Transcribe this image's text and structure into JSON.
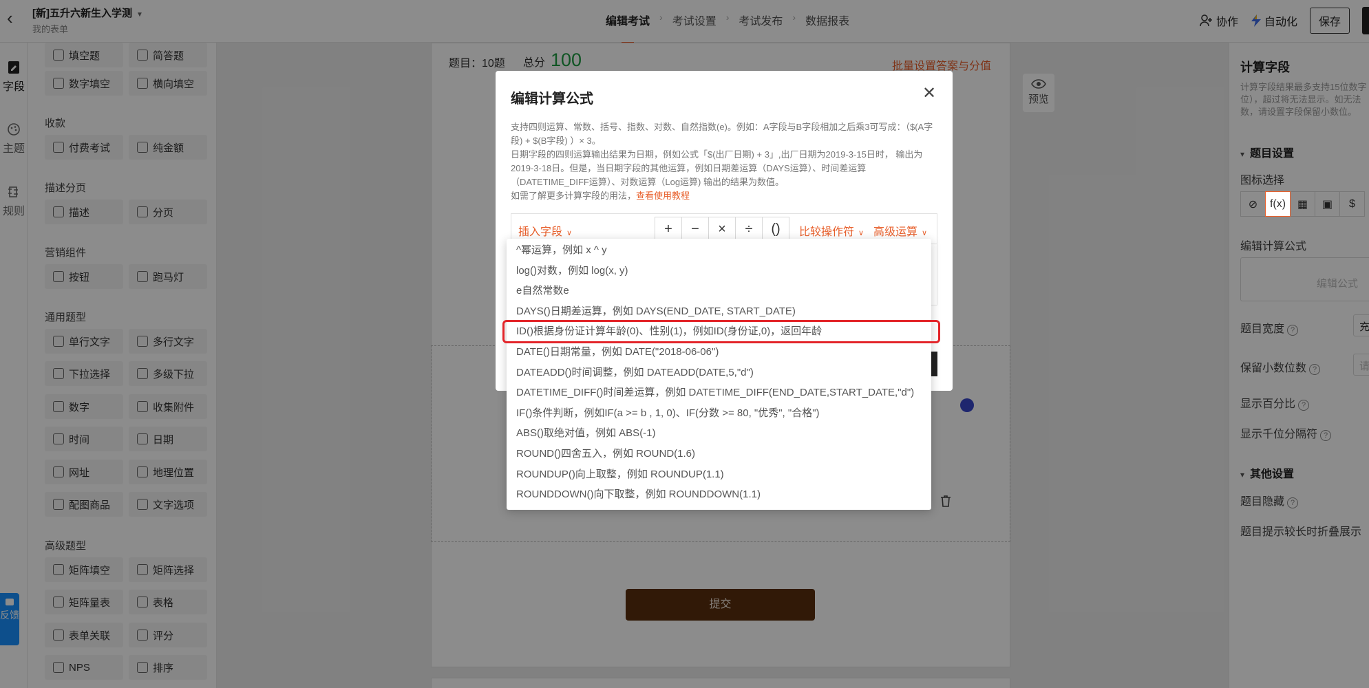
{
  "topbar": {
    "title": "[新]五升六新生入学测",
    "subtitle": "我的表单",
    "steps": [
      "编辑考试",
      "考试设置",
      "考试发布",
      "数据报表"
    ],
    "collaborate": "协作",
    "automate": "自动化",
    "save": "保存"
  },
  "rail": {
    "items": [
      {
        "label": "字段",
        "icon": "field-icon"
      },
      {
        "label": "主题",
        "icon": "palette-icon"
      },
      {
        "label": "规则",
        "icon": "rules-icon"
      }
    ],
    "feedback": "反馈"
  },
  "palette": {
    "top_items": [
      "填空题",
      "简答题",
      "数字填空",
      "横向填空"
    ],
    "groups": [
      {
        "title": "收款",
        "items": [
          "付费考试",
          "纯金额"
        ]
      },
      {
        "title": "描述分页",
        "items": [
          "描述",
          "分页"
        ]
      },
      {
        "title": "营销组件",
        "items": [
          "按钮",
          "跑马灯"
        ]
      },
      {
        "title": "通用题型",
        "items": [
          "单行文字",
          "多行文字",
          "下拉选择",
          "多级下拉",
          "数字",
          "收集附件",
          "时间",
          "日期",
          "网址",
          "地理位置",
          "配图商品",
          "文字选项"
        ]
      },
      {
        "title": "高级题型",
        "items": [
          "矩阵填空",
          "矩阵选择",
          "矩阵量表",
          "表格",
          "表单关联",
          "评分",
          "NPS",
          "排序"
        ]
      }
    ]
  },
  "canvas": {
    "question_count": "题目：10题",
    "total_label": "总分",
    "total_value": "100",
    "bulk_link": "批量设置答案与分值",
    "preview": "预览",
    "submit": "提交"
  },
  "right_panel": {
    "title": "计算字段",
    "desc": "计算字段结果最多支持15位数字位），超过将无法显示。如无法数，请设置字段保留小数位。",
    "section_question": "题目设置",
    "icon_select": "图标选择",
    "formula_label": "编辑计算公式",
    "formula_btn": "编辑公式",
    "width_label": "题目宽度",
    "width_value": "充",
    "decimal_label": "保留小数位数",
    "decimal_value": "请",
    "percent_label": "显示百分比",
    "thousands_label": "显示千位分隔符",
    "section_other": "其他设置",
    "hidden_label": "题目隐藏",
    "collapse_label": "题目提示较长时折叠展示"
  },
  "modal": {
    "title": "编辑计算公式",
    "desc_lines": [
      "支持四则运算、常数、括号、指数、对数、自然指数(e)。例如：A字段与B字段相加之后乘3可写成：（$(A字段) + $(B字段) ）× 3。",
      "日期字段的四则运算输出结果为日期，例如公式「$(出厂日期) + 3」,出厂日期为2019-3-15日时， 输出为2019-3-18日。但是，当日期字段的其他运算，例如日期差运算（DAYS运算）、时间差运算（DATETIME_DIFF运算）、对数运算（Log运算) 输出的结果为数值。"
    ],
    "help_prefix": "如需了解更多计算字段的用法，",
    "help_link": "查看使用教程",
    "insert_field": "插入字段",
    "operators": [
      "+",
      "−",
      "×",
      "÷",
      "()"
    ],
    "compare": "比较操作符",
    "advanced": "高级运算"
  },
  "dropdown": {
    "items": [
      "^幂运算，例如 x ^ y",
      "log()对数，例如 log(x, y)",
      "e自然常数e",
      "DAYS()日期差运算，例如 DAYS(END_DATE, START_DATE)",
      "ID()根据身份证计算年龄(0)、性别(1)，例如ID(身份证,0)，返回年龄",
      "DATE()日期常量，例如 DATE(\"2018-06-06\")",
      "DATEADD()时间调整，例如 DATEADD(DATE,5,\"d\")",
      "DATETIME_DIFF()时间差运算，例如 DATETIME_DIFF(END_DATE,START_DATE,\"d\")",
      "IF()条件判断，例如IF(a >= b , 1, 0)、IF(分数 >= 80, \"优秀\", \"合格\")",
      "ABS()取绝对值，例如 ABS(-1)",
      "ROUND()四舍五入，例如 ROUND(1.6)",
      "ROUNDUP()向上取整，例如 ROUNDUP(1.1)",
      "ROUNDDOWN()向下取整，例如 ROUNDDOWN(1.1)"
    ],
    "highlighted_index": 4
  },
  "colors": {
    "accent": "#e8602c",
    "score_green": "#1e9c43",
    "highlight_red": "#e3252a",
    "submit_brown": "#5a2f0e",
    "feedback_blue": "#1890ff"
  }
}
